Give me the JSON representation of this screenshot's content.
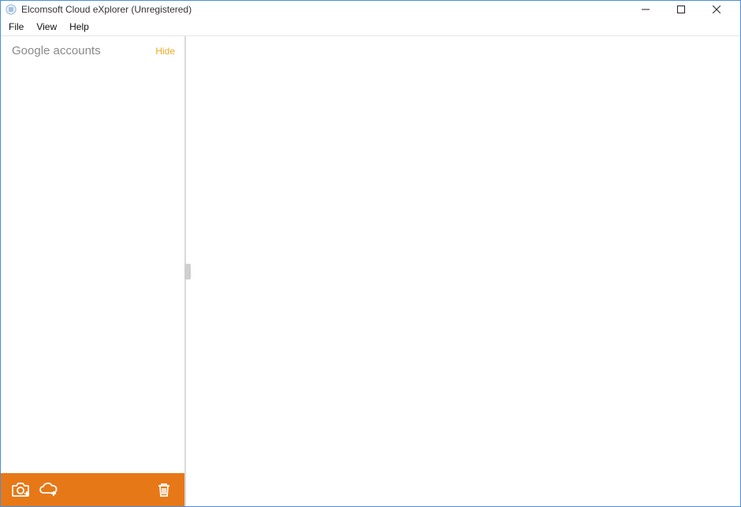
{
  "title": "Elcomsoft Cloud eXplorer (Unregistered)",
  "menu": {
    "file": "File",
    "view": "View",
    "help": "Help"
  },
  "sidebar": {
    "heading": "Google accounts",
    "hide_label": "Hide"
  },
  "colors": {
    "accent": "#e77817",
    "link": "#f5a623"
  }
}
